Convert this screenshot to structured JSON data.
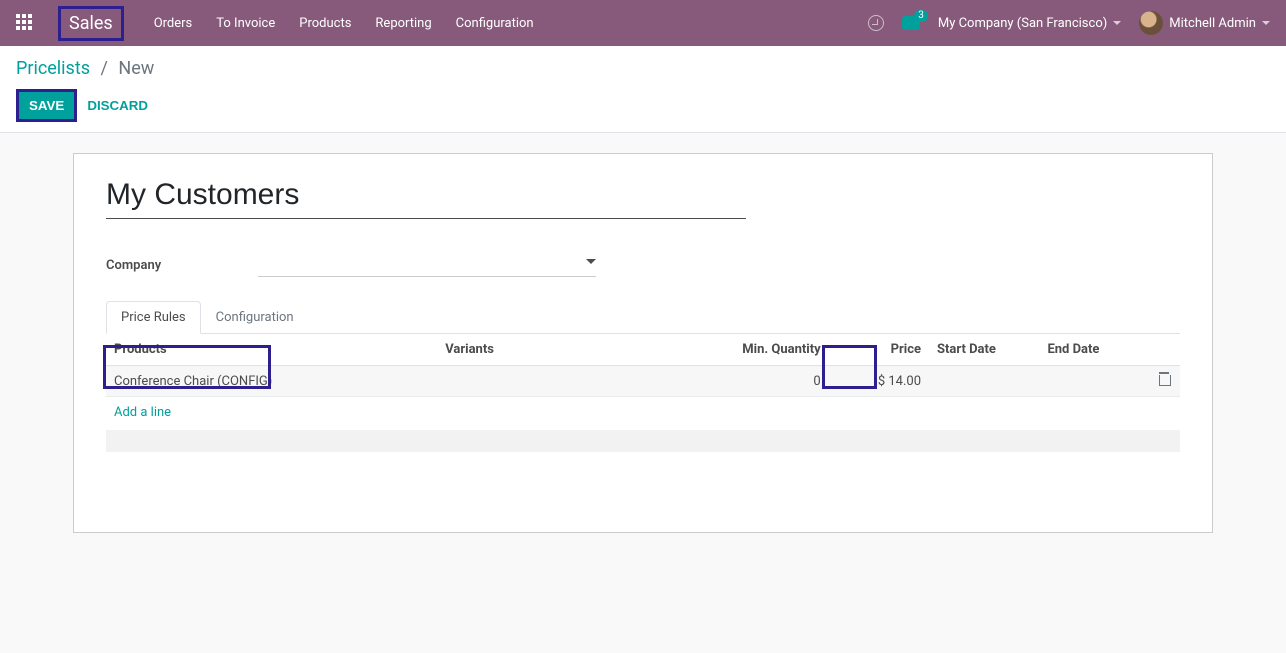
{
  "topbar": {
    "brand": "Sales",
    "nav": [
      "Orders",
      "To Invoice",
      "Products",
      "Reporting",
      "Configuration"
    ],
    "msg_count": "3",
    "company": "My Company (San Francisco)",
    "user": "Mitchell Admin"
  },
  "breadcrumb": {
    "root": "Pricelists",
    "leaf": "New"
  },
  "buttons": {
    "save": "Save",
    "discard": "Discard"
  },
  "form": {
    "title": "My Customers",
    "company_label": "Company",
    "company_value": ""
  },
  "tabs": {
    "price_rules": "Price Rules",
    "configuration": "Configuration"
  },
  "table": {
    "headers": {
      "products": "Products",
      "variants": "Variants",
      "min_qty": "Min. Quantity",
      "price": "Price",
      "start": "Start Date",
      "end": "End Date"
    },
    "rows": [
      {
        "product": "Conference Chair (CONFIG)",
        "variants": "",
        "min_qty": "0",
        "price": "$ 14.00",
        "start": "",
        "end": ""
      }
    ],
    "add_line": "Add a line"
  }
}
